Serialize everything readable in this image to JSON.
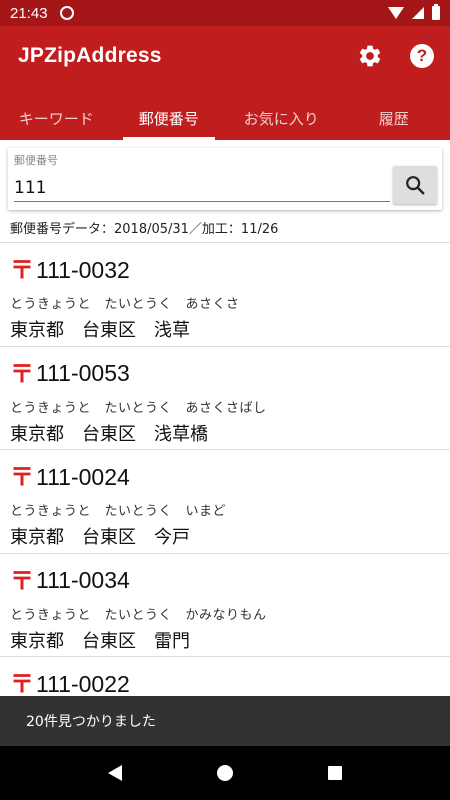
{
  "status_bar": {
    "time": "21:43"
  },
  "app": {
    "title": "JPZipAddress",
    "colors": {
      "primary": "#c01d1f",
      "status": "#a51619",
      "accent": "#e02020"
    },
    "actions": {
      "settings_icon": "gear-icon",
      "help_icon": "help-icon",
      "help_glyph": "?"
    }
  },
  "tabs": [
    {
      "label": "キーワード",
      "active": false
    },
    {
      "label": "郵便番号",
      "active": true
    },
    {
      "label": "お気に入り",
      "active": false
    },
    {
      "label": "履歴",
      "active": false
    }
  ],
  "search": {
    "label": "郵便番号",
    "value": "111",
    "button_icon": "search-icon"
  },
  "data_info": "郵便番号データ：2018/05/31／加工：11/26",
  "results": [
    {
      "mark": "〒",
      "code": "111-0032",
      "kana": "とうきょうと　たいとうく　あさくさ",
      "address": "東京都　台東区　浅草"
    },
    {
      "mark": "〒",
      "code": "111-0053",
      "kana": "とうきょうと　たいとうく　あさくさばし",
      "address": "東京都　台東区　浅草橋"
    },
    {
      "mark": "〒",
      "code": "111-0024",
      "kana": "とうきょうと　たいとうく　いまど",
      "address": "東京都　台東区　今戸"
    },
    {
      "mark": "〒",
      "code": "111-0034",
      "kana": "とうきょうと　たいとうく　かみなりもん",
      "address": "東京都　台東区　雷門"
    },
    {
      "mark": "〒",
      "code": "111-0022",
      "kana": "",
      "address": ""
    }
  ],
  "snackbar": {
    "message": "20件見つかりました"
  },
  "nav": {
    "back_icon": "back-icon",
    "home_icon": "home-icon",
    "recent_icon": "recent-apps-icon"
  }
}
